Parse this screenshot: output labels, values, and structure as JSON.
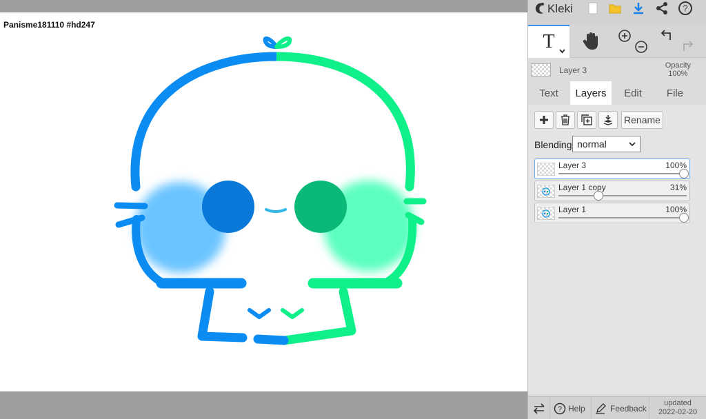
{
  "canvas": {
    "label": "Panisme181110 #hd247"
  },
  "app": {
    "name": "Kleki"
  },
  "topbar": {
    "icons": [
      "kleki-logo-icon",
      "new-document-icon",
      "open-file-icon",
      "download-icon",
      "share-icon",
      "help-icon"
    ]
  },
  "tools": {
    "text_glyph": "T",
    "icons": [
      "text-tool-icon",
      "hand-tool-icon",
      "zoom-in-icon",
      "zoom-out-icon",
      "undo-icon",
      "redo-icon"
    ]
  },
  "current_layer": {
    "name": "Layer 3",
    "opacity_label": "Opacity",
    "opacity_value": "100%"
  },
  "tabs": [
    {
      "label": "Text",
      "active": false
    },
    {
      "label": "Layers",
      "active": true
    },
    {
      "label": "Edit",
      "active": false
    },
    {
      "label": "File",
      "active": false
    }
  ],
  "layer_actions": {
    "rename_label": "Rename",
    "icons": [
      "add-layer-icon",
      "delete-layer-icon",
      "duplicate-layer-icon",
      "merge-down-icon"
    ]
  },
  "blending": {
    "label": "Blending",
    "value": "normal"
  },
  "layers": [
    {
      "name": "Layer 3",
      "opacity": "100%",
      "opacity_fraction": 1.0,
      "selected": true
    },
    {
      "name": "Layer 1 copy",
      "opacity": "31%",
      "opacity_fraction": 0.31,
      "selected": false
    },
    {
      "name": "Layer 1",
      "opacity": "100%",
      "opacity_fraction": 1.0,
      "selected": false
    }
  ],
  "bottombar": {
    "help_label": "Help",
    "feedback_label": "Feedback",
    "updated_label": "updated",
    "updated_date": "2022-02-20"
  },
  "colors": {
    "blue": "#0a8cf2",
    "green": "#10f08a",
    "light_blue": "#6cc4ff",
    "light_green": "#5cffc0",
    "dark_blue": "#0a78d8",
    "dark_green": "#0ab878",
    "accent": "#3d8fea"
  }
}
